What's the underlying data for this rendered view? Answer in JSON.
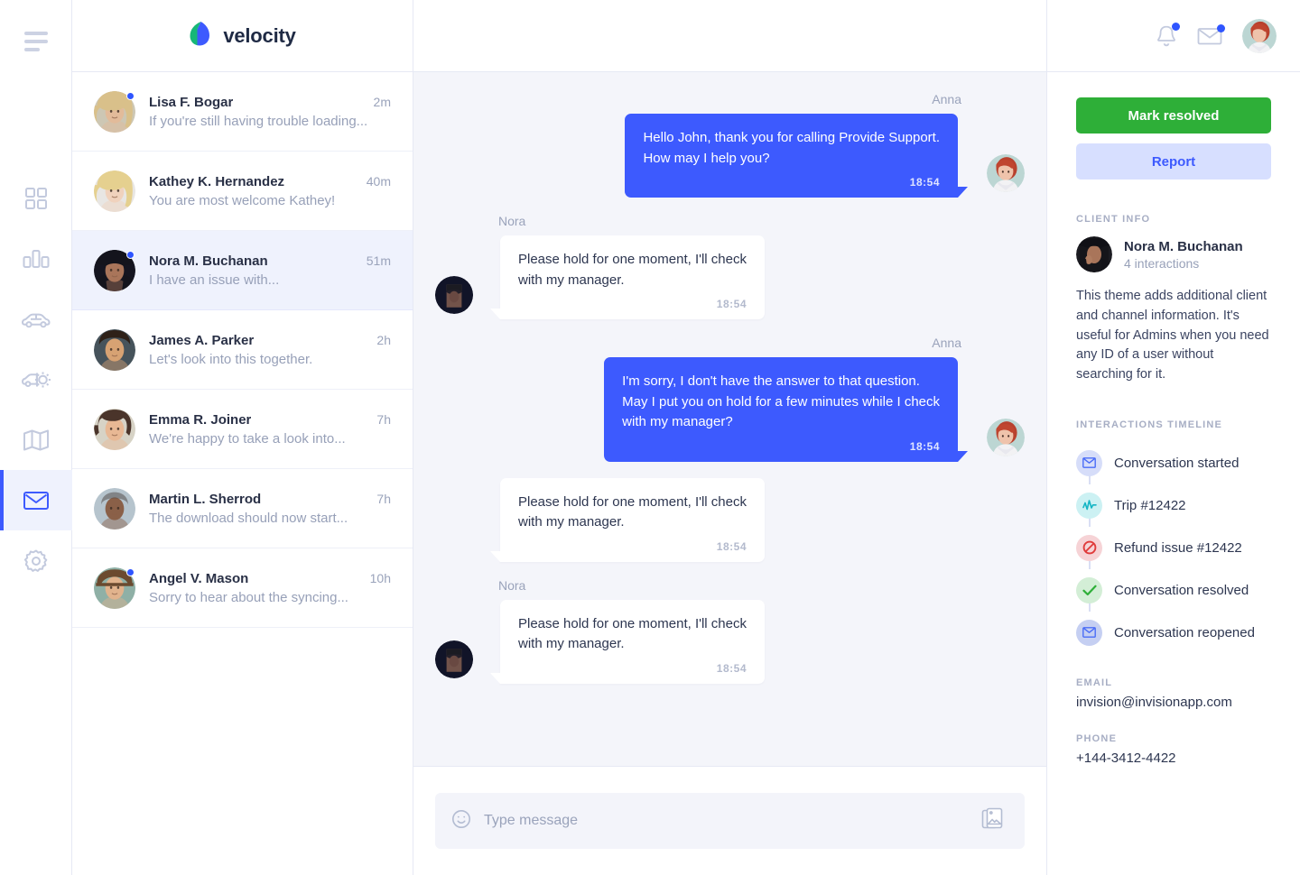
{
  "brand": {
    "name": "velocity",
    "logo_icon": "leaf-logo-icon",
    "colors": {
      "leaf_green": "#16b877",
      "leaf_blue": "#3d5afe"
    }
  },
  "theme": {
    "accent_blue": "#3d5afe",
    "resolve_green": "#2eaf38",
    "chat_bg": "#f4f5fa",
    "selected_bg": "#eff2fd"
  },
  "rail": {
    "menu_icon": "hamburger-menu-icon",
    "items": [
      {
        "icon": "grid-dashboard-icon",
        "name": "dashboard",
        "active": false
      },
      {
        "icon": "bar-chart-icon",
        "name": "analytics",
        "active": false
      },
      {
        "icon": "car-icon",
        "name": "vehicles",
        "active": false
      },
      {
        "icon": "car-service-icon",
        "name": "service",
        "active": false
      },
      {
        "icon": "map-icon",
        "name": "map",
        "active": false
      },
      {
        "icon": "mail-icon",
        "name": "messages",
        "active": true
      },
      {
        "icon": "gear-icon",
        "name": "settings",
        "active": false
      }
    ]
  },
  "conversations": [
    {
      "name": "Lisa F. Bogar",
      "preview": "If you're still having trouble loading...",
      "time": "2m",
      "unread": true,
      "selected": false
    },
    {
      "name": "Kathey K. Hernandez",
      "preview": "You are most welcome Kathey!",
      "time": "40m",
      "unread": false,
      "selected": false
    },
    {
      "name": "Nora M. Buchanan",
      "preview": "I have an issue with...",
      "time": "51m",
      "unread": true,
      "selected": true
    },
    {
      "name": "James A. Parker",
      "preview": "Let's look into this together.",
      "time": "2h",
      "unread": false,
      "selected": false
    },
    {
      "name": "Emma R. Joiner",
      "preview": "We're happy to take a look into...",
      "time": "7h",
      "unread": false,
      "selected": false
    },
    {
      "name": "Martin L. Sherrod",
      "preview": "The download should now start...",
      "time": "7h",
      "unread": false,
      "selected": false
    },
    {
      "name": "Angel V. Mason",
      "preview": "Sorry to hear about the syncing...",
      "time": "10h",
      "unread": true,
      "selected": false
    }
  ],
  "chat": {
    "messages": [
      {
        "author": "Anna",
        "side": "right",
        "text": "Hello John, thank you for calling Provide Support.\nHow may I help you?",
        "time": "18:54",
        "show_author": true,
        "show_avatar": true
      },
      {
        "author": "Nora",
        "side": "left",
        "text": "Please hold for one moment, I'll check\nwith my manager.",
        "time": "18:54",
        "show_author": true,
        "show_avatar": true
      },
      {
        "author": "Anna",
        "side": "right",
        "text": "I'm sorry, I don't have the answer to that question.\nMay I put you on hold for a few minutes while I check\nwith my manager?",
        "time": "18:54",
        "show_author": true,
        "show_avatar": true
      },
      {
        "author": "Nora",
        "side": "left",
        "text": "Please hold for one moment, I'll check\nwith my manager.",
        "time": "18:54",
        "show_author": false,
        "show_avatar": false
      },
      {
        "author": "Nora",
        "side": "left",
        "text": "Please hold for one moment, I'll check\nwith my manager.",
        "time": "18:54",
        "show_author": true,
        "show_avatar": true
      }
    ]
  },
  "composer": {
    "placeholder": "Type message",
    "value": "",
    "emoji_icon": "smiley-icon",
    "attach_icon": "image-attachment-icon"
  },
  "header": {
    "bell_icon": "bell-notification-icon",
    "mail_icon": "envelope-icon",
    "avatar_icon": "user-avatar",
    "bell_has_badge": true,
    "mail_has_badge": true
  },
  "right_panel": {
    "resolve_label": "Mark resolved",
    "report_label": "Report",
    "client_info_label": "CLIENT INFO",
    "client": {
      "name": "Nora M. Buchanan",
      "interactions": "4 interactions",
      "description": "This theme adds additional client and channel information. It's useful for Admins when you need any ID of a user without searching for it."
    },
    "timeline_label": "INTERACTIONS TIMELINE",
    "timeline": [
      {
        "text": "Conversation started",
        "icon": "envelope-icon",
        "color": "#4a6cf7",
        "bg": "#d6ddf9"
      },
      {
        "text": "Trip #12422",
        "icon": "activity-pulse-icon",
        "color": "#14b5c4",
        "bg": "#ccf1f3"
      },
      {
        "text": "Refund issue #12422",
        "icon": "block-forbidden-icon",
        "color": "#e03b3b",
        "bg": "#f6d3d6"
      },
      {
        "text": "Conversation resolved",
        "icon": "check-icon",
        "color": "#2eaf38",
        "bg": "#d3eed6"
      },
      {
        "text": "Conversation reopened",
        "icon": "envelope-icon",
        "color": "#4a6cf7",
        "bg": "#c5cff2"
      }
    ],
    "email_label": "EMAIL",
    "email_value": "invision@invisionapp.com",
    "phone_label": "PHONE",
    "phone_value": "+144-3412-4422"
  }
}
